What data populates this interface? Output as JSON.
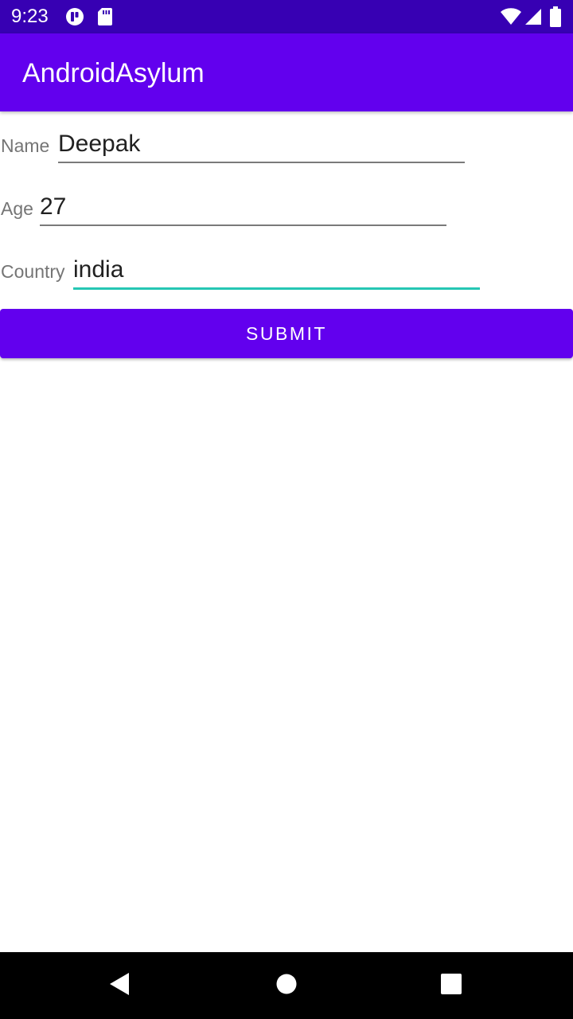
{
  "status_bar": {
    "time": "9:23",
    "icons": [
      "pocket-icon",
      "sd-card-icon",
      "wifi-icon",
      "cell-signal-icon",
      "battery-icon"
    ]
  },
  "app_bar": {
    "title": "AndroidAsylum"
  },
  "form": {
    "name": {
      "label": "Name",
      "value": "Deepak"
    },
    "age": {
      "label": "Age",
      "value": "27"
    },
    "country": {
      "label": "Country",
      "value": "india"
    }
  },
  "submit": {
    "label": "SUBMIT"
  },
  "nav_bar": {
    "icons": [
      "back-icon",
      "home-icon",
      "recents-icon"
    ]
  },
  "colors": {
    "status_bar": "#3700b3",
    "primary": "#6200ee",
    "focus_accent": "#26c6b4"
  }
}
